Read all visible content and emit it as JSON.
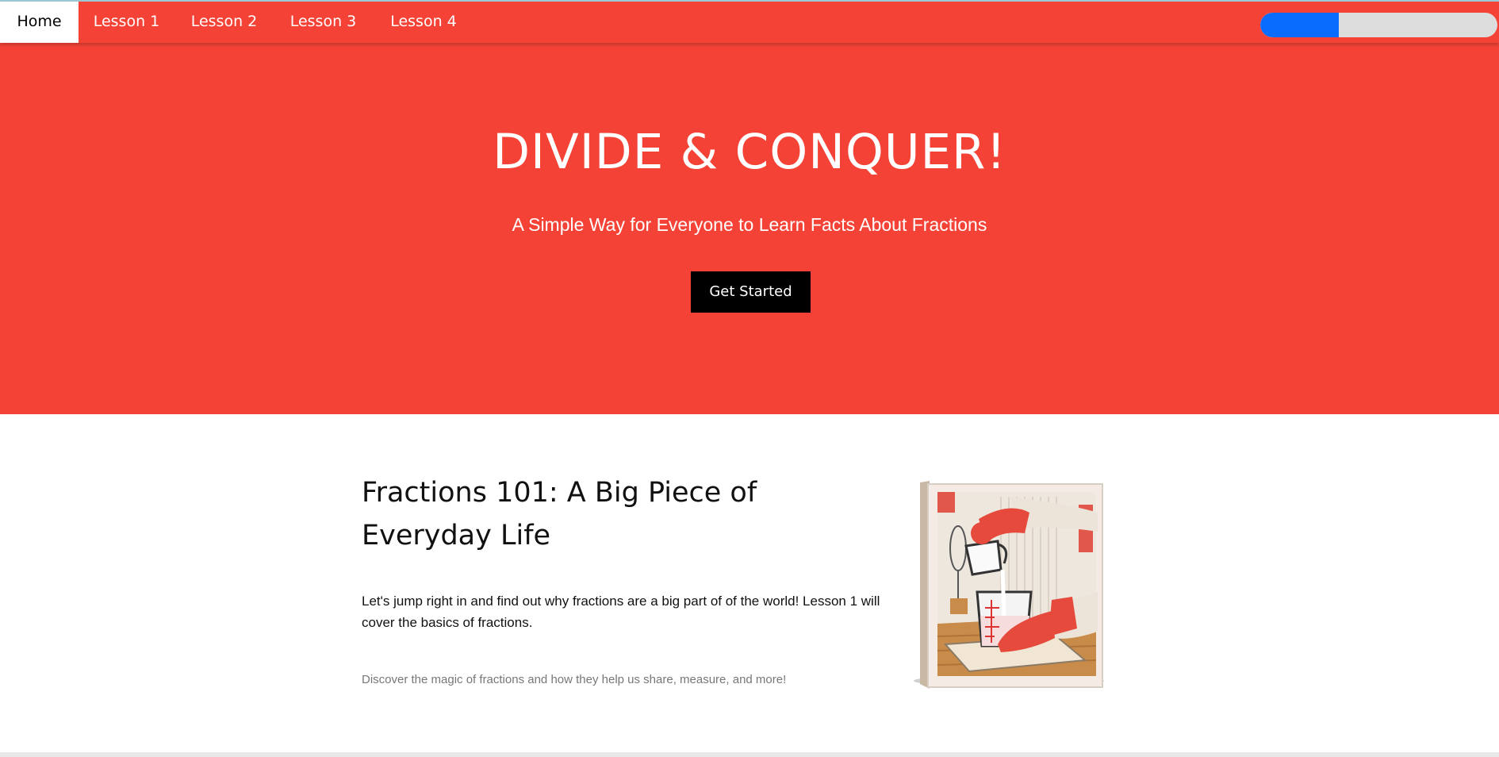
{
  "nav": {
    "items": [
      {
        "label": "Home",
        "active": true
      },
      {
        "label": "Lesson 1",
        "active": false
      },
      {
        "label": "Lesson 2",
        "active": false
      },
      {
        "label": "Lesson 3",
        "active": false
      },
      {
        "label": "Lesson 4",
        "active": false
      }
    ],
    "progress_percent": 33,
    "colors": {
      "bar": "#f44336",
      "progress_fill": "#0a6cff",
      "progress_track": "#dddddd"
    }
  },
  "hero": {
    "title": "DIVIDE & CONQUER!",
    "subtitle": "A Simple Way for Everyone to Learn Facts About Fractions",
    "cta_label": "Get Started"
  },
  "lesson": {
    "heading": "Fractions 101: A Big Piece of Everyday Life",
    "body": "Let's jump right in and find out why fractions are a big part of of the world! Lesson 1 will cover the basics of fractions.",
    "caption": "Discover the magic of fractions and how they help us share, measure, and more!",
    "image_icon": "measuring-cup-illustration"
  }
}
